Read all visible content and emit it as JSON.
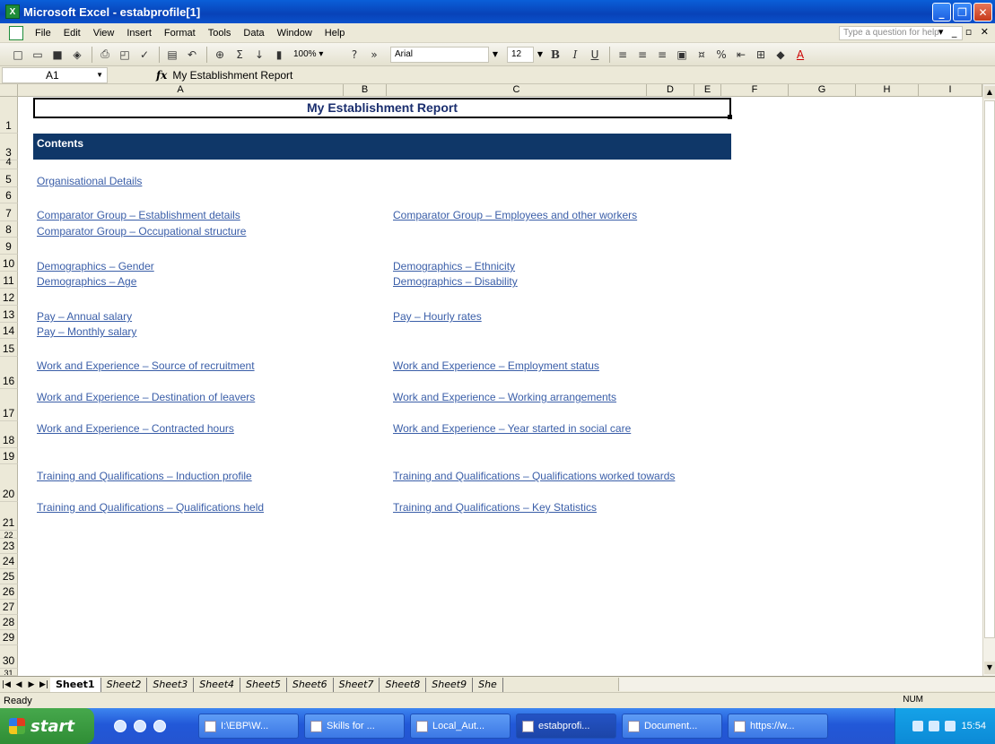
{
  "window": {
    "title": "Microsoft Excel - estabprofile[1]"
  },
  "menu": {
    "items": [
      "File",
      "Edit",
      "View",
      "Insert",
      "Format",
      "Tools",
      "Data",
      "Window",
      "Help"
    ],
    "help_placeholder": "Type a question for help"
  },
  "toolbar": {
    "zoom": "100%",
    "font": "Arial",
    "font_size": "12",
    "bold": "B",
    "italic": "I",
    "underline": "U",
    "percent": "%"
  },
  "formula_bar": {
    "cell_ref": "A1",
    "fx": "fx",
    "content": "My Establishment Report"
  },
  "columns": [
    "A",
    "B",
    "C",
    "D",
    "E",
    "F",
    "G",
    "H",
    "I"
  ],
  "rows": [
    "1",
    "3",
    "4",
    "5",
    "6",
    "7",
    "8",
    "9",
    "10",
    "11",
    "12",
    "13",
    "14",
    "15",
    "16",
    "17",
    "18",
    "19",
    "20",
    "21",
    "22",
    "23",
    "24",
    "25",
    "26",
    "27",
    "28",
    "29",
    "30",
    "31"
  ],
  "sheet": {
    "report_title": "My Establishment Report",
    "contents_label": "Contents",
    "links_left": [
      "Organisational Details",
      "Comparator Group – Establishment details",
      "Comparator Group – Occupational structure",
      "Demographics – Gender",
      "Demographics – Age",
      "Pay – Annual salary",
      "Pay – Monthly salary",
      "Work and Experience – Source of recruitment",
      "Work and Experience – Destination of leavers",
      "Work and Experience – Contracted hours",
      "Training and Qualifications – Induction profile",
      "Training and Qualifications – Qualifications held"
    ],
    "links_right": [
      "Comparator Group – Employees and other workers",
      "Demographics – Ethnicity",
      "Demographics – Disability",
      "Pay – Hourly rates",
      "Work and Experience – Employment status",
      "Work and Experience – Working arrangements",
      "Work and Experience – Year started in social care",
      "Training and Qualifications – Qualifications worked towards",
      "Training and Qualifications – Key Statistics"
    ]
  },
  "sheet_tabs": [
    "Sheet1",
    "Sheet2",
    "Sheet3",
    "Sheet4",
    "Sheet5",
    "Sheet6",
    "Sheet7",
    "Sheet8",
    "Sheet9",
    "She"
  ],
  "status": {
    "left": "Ready",
    "num": "NUM"
  },
  "taskbar": {
    "start_label": "start",
    "buttons": [
      "I:\\EBP\\W...",
      "Skills for ...",
      "Local_Aut...",
      "estabprofi...",
      "Document...",
      "https://w..."
    ],
    "clock": "15:54"
  }
}
